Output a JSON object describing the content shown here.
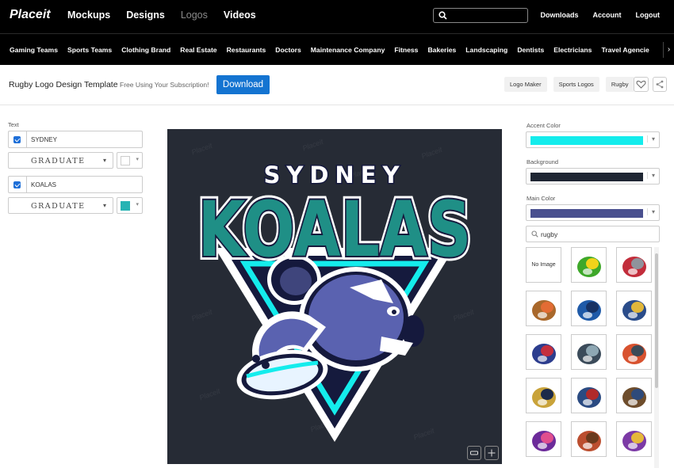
{
  "brand": "Placeit",
  "nav": [
    "Mockups",
    "Designs",
    "Logos",
    "Videos"
  ],
  "account_nav": [
    "Downloads",
    "Account",
    "Logout"
  ],
  "categories": [
    "Gaming Teams",
    "Sports Teams",
    "Clothing Brand",
    "Real Estate",
    "Restaurants",
    "Doctors",
    "Maintenance Company",
    "Fitness",
    "Bakeries",
    "Landscaping",
    "Dentists",
    "Electricians",
    "Travel Agencie"
  ],
  "page": {
    "title": "Rugby Logo Design Template",
    "subscription_note": "Free Using Your Subscription!",
    "download_label": "Download",
    "tags": [
      "Logo Maker",
      "Sports Logos",
      "Rugby"
    ]
  },
  "left_panel": {
    "text_label": "Text",
    "lines": [
      {
        "text": "SYDNEY",
        "font": "GRADUATE",
        "color": "#ffffff"
      },
      {
        "text": "KOALAS",
        "font": "GRADUATE",
        "color": "#27b3b3"
      }
    ]
  },
  "logo": {
    "top_text": "SYDNEY",
    "main_text": "KOALAS",
    "watermark": "Placeit"
  },
  "right_panel": {
    "accent_label": "Accent Color",
    "accent_color": "#14ecec",
    "background_label": "Background",
    "background_color": "#1f2633",
    "main_label": "Main Color",
    "main_color": "#4a508f",
    "search_value": "rugby",
    "no_image_label": "No Image"
  },
  "icons": {
    "search": "search-icon",
    "heart": "heart-icon",
    "share": "share-icon",
    "chevron": "chevron-down-icon"
  }
}
